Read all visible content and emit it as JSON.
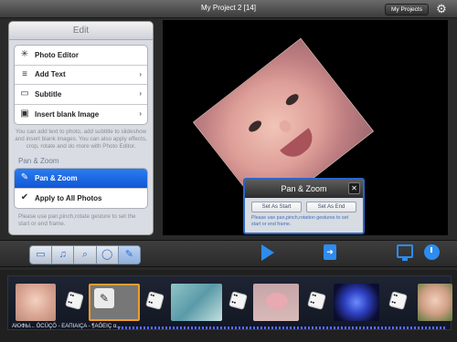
{
  "topbar": {
    "title": "My Project 2  [14]",
    "my_projects": "My Projects",
    "gear_icon": "gear-icon"
  },
  "panel": {
    "title": "Edit",
    "items": [
      {
        "label": "Photo Editor",
        "icon": "wand-icon"
      },
      {
        "label": "Add Text",
        "icon": "text-icon"
      },
      {
        "label": "Subtitle",
        "icon": "speech-bubble-icon"
      },
      {
        "label": "Insert blank Image",
        "icon": "image-icon"
      }
    ],
    "description": "You can add text to photo, add subtitle to slideshow and insert blank images. You can also apply effects, crop, rotate and do more with Photo Editor.",
    "section": "Pan & Zoom",
    "pan_items": [
      {
        "label": "Pan & Zoom",
        "selected": true
      },
      {
        "label": "Apply to All Photos",
        "selected": false
      }
    ],
    "pan_description": "Please use pan,pinch,rotate gesture to set the start or end frame."
  },
  "dialog": {
    "title": "Pan & Zoom",
    "set_start": "Set As Start",
    "set_end": "Set As End",
    "help": "Please use pan,pinch,rotation gestures to set start or end frame."
  },
  "timeline": {
    "caption": "AЮФЫ... ÖCÜÇÖ - ΕΑΠΙΑΙÇΑ - ¶ΑÖΕΙÇ α..."
  },
  "colors": {
    "accent": "#2d8cf0",
    "selected_row": "#1a62dc",
    "dialog_border": "#2a66c9",
    "selected_thumb_border": "#f39c2a"
  }
}
